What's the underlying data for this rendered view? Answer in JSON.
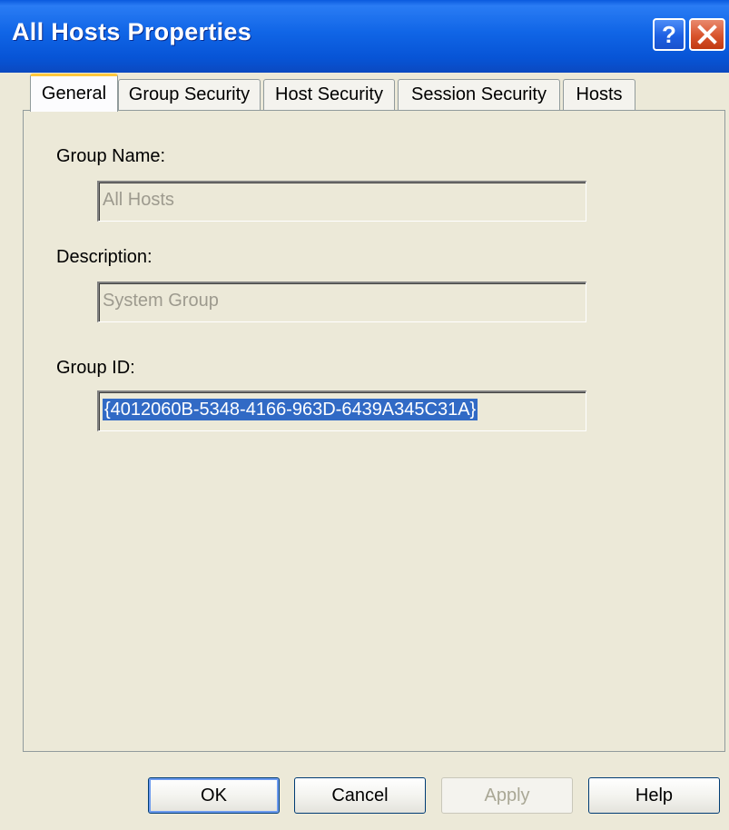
{
  "window": {
    "title": "All Hosts Properties"
  },
  "titlebar": {
    "help_glyph": "?",
    "close_glyph": "✕"
  },
  "tabs": [
    {
      "label": "General",
      "active": true
    },
    {
      "label": "Group Security",
      "active": false
    },
    {
      "label": "Host Security",
      "active": false
    },
    {
      "label": "Session Security",
      "active": false
    },
    {
      "label": "Hosts",
      "active": false
    }
  ],
  "general": {
    "group_name_label": "Group Name:",
    "group_name_value": "All Hosts",
    "description_label": "Description:",
    "description_value": "System Group",
    "group_id_label": "Group ID:",
    "group_id_value": "{4012060B-5348-4166-963D-6439A345C31A}"
  },
  "buttons": {
    "ok": "OK",
    "cancel": "Cancel",
    "apply": "Apply",
    "help": "Help"
  },
  "colors": {
    "titlebar": "#0754d6",
    "active_tab_highlight": "#ffc83c",
    "selection": "#316ac5",
    "close_button": "#d8532c"
  }
}
